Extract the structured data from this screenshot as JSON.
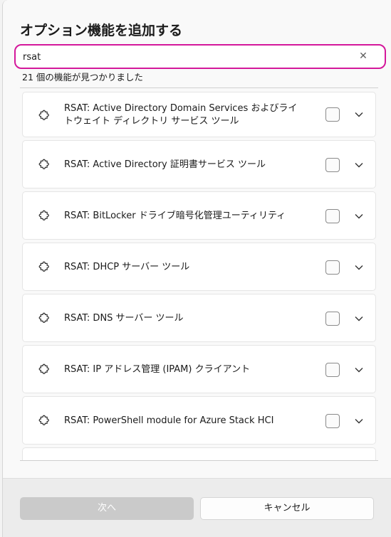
{
  "dialog": {
    "title": "オプション機能を追加する",
    "search": {
      "value": "rsat",
      "clear_icon": "close-icon"
    },
    "result_count": "21 個の機能が見つかりました",
    "features": [
      {
        "label": "RSAT: Active Directory Domain Services およびライトウェイト ディレクトリ サービス ツール",
        "checked": false
      },
      {
        "label": "RSAT: Active Directory 証明書サービス ツール",
        "checked": false
      },
      {
        "label": "RSAT: BitLocker ドライブ暗号化管理ユーティリティ",
        "checked": false
      },
      {
        "label": "RSAT: DHCP サーバー ツール",
        "checked": false
      },
      {
        "label": "RSAT: DNS サーバー ツール",
        "checked": false
      },
      {
        "label": "RSAT: IP アドレス管理 (IPAM) クライアント",
        "checked": false
      },
      {
        "label": "RSAT: PowerShell module for Azure Stack HCI",
        "checked": false
      }
    ],
    "buttons": {
      "next": "次へ",
      "cancel": "キャンセル"
    },
    "colors": {
      "focus_border": "#d4189b",
      "disabled_button": "#cacaca"
    }
  }
}
